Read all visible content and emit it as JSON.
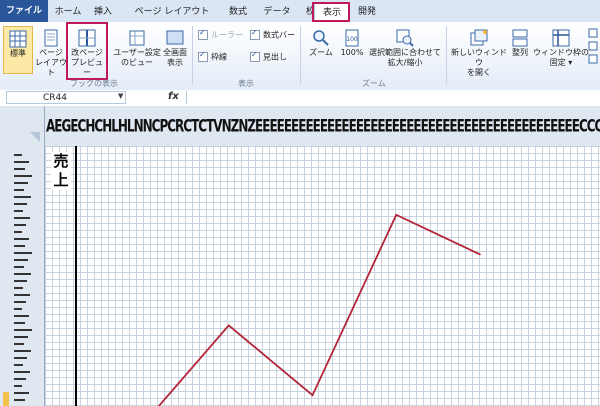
{
  "tabs": [
    {
      "label": "ファイル"
    },
    {
      "label": "ホーム"
    },
    {
      "label": "挿入"
    },
    {
      "label": "ページ レイアウト"
    },
    {
      "label": "数式"
    },
    {
      "label": "データ"
    },
    {
      "label": "校閲"
    },
    {
      "label": "表示"
    },
    {
      "label": "開発"
    }
  ],
  "active_tab": "表示",
  "ribbon": {
    "workbook_views": {
      "normal": "標準",
      "page_layout_1": "ページ",
      "page_layout_2": "レイアウト",
      "page_break_1": "改ページ",
      "page_break_2": "プレビュー",
      "custom_views_1": "ユーザー設定",
      "custom_views_2": "のビュー",
      "full_screen_1": "全画面",
      "full_screen_2": "表示",
      "group_label": "ブックの表示"
    },
    "show": {
      "ruler": "ルーラー",
      "formula_bar": "数式バー",
      "gridlines": "枠線",
      "headings": "見出し",
      "group_label": "表示"
    },
    "zoom": {
      "zoom": "ズーム",
      "hundred": "100%",
      "zoom_selection_1": "選択範囲に合わせて",
      "zoom_selection_2": "拡大/縮小",
      "group_label": "ズーム"
    },
    "window": {
      "new_window_1": "新しいウィンドウ",
      "new_window_2": "を開く",
      "arrange": "整列",
      "freeze_1": "ウィンドウ枠の",
      "freeze_2": "固定 ▾"
    }
  },
  "formula_bar": {
    "name_box": "CR44",
    "fx": "fx"
  },
  "column_headers": "AEGECHCHLHLNNCPCRCTCTVNZNZEEEEEEEEEEEEEEEEEEEEEEEEEEEEEEEEEEEEEEEEEEEEECCCCCCCC",
  "sheet": {
    "title": [
      "売",
      "上"
    ]
  },
  "chart_data": {
    "type": "line",
    "title": "",
    "xlabel": "",
    "ylabel": "",
    "x": [
      1,
      2,
      3,
      4,
      5
    ],
    "values": [
      0,
      0.83,
      0.23,
      1.78,
      1.44
    ],
    "ylim": [
      0,
      2.2
    ],
    "color": "#b5253a"
  },
  "colors": {
    "highlight": "#c0185a",
    "file_tab": "#2a579a",
    "ribbon_bg": "#e4ecf7"
  }
}
